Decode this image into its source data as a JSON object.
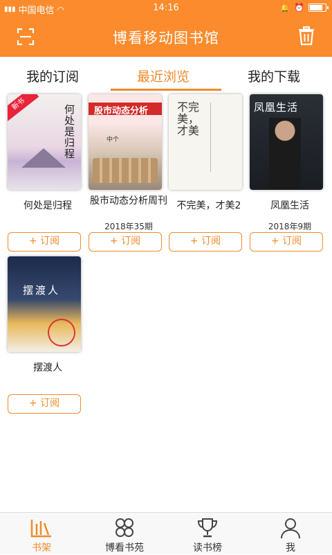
{
  "status": {
    "carrier": "中国电信",
    "time": "14:16",
    "battery_level": 0.85
  },
  "header": {
    "title": "博看移动图书馆",
    "scan_icon": "scan-icon",
    "trash_icon": "trash-icon"
  },
  "tabs": [
    {
      "label": "我的订阅",
      "active": false
    },
    {
      "label": "最近浏览",
      "active": true
    },
    {
      "label": "我的下载",
      "active": false
    }
  ],
  "books": [
    {
      "name": "何处是归程",
      "issue": "",
      "cover_title": "何处是归程",
      "badge": "新书"
    },
    {
      "name": "股市动态分析周刊",
      "issue": "2018年35期",
      "cover_title": "股市动态分析",
      "cover_sub": "中个"
    },
    {
      "name": "不完美，才美2",
      "issue": "",
      "cover_title": "不完美，才美"
    },
    {
      "name": "凤凰生活",
      "issue": "2018年9期",
      "cover_title": "凤凰生活"
    },
    {
      "name": "摆渡人",
      "issue": "",
      "cover_title": "摆渡人"
    }
  ],
  "subscribe_label": "+ 订阅",
  "bottom_nav": [
    {
      "label": "书架",
      "icon": "bookshelf-icon",
      "active": true
    },
    {
      "label": "博看书苑",
      "icon": "clover-icon",
      "active": false
    },
    {
      "label": "读书榜",
      "icon": "trophy-icon",
      "active": false
    },
    {
      "label": "我",
      "icon": "person-icon",
      "active": false
    }
  ],
  "colors": {
    "accent": "#fb8b2c",
    "accent_text": "#f08a2a"
  }
}
